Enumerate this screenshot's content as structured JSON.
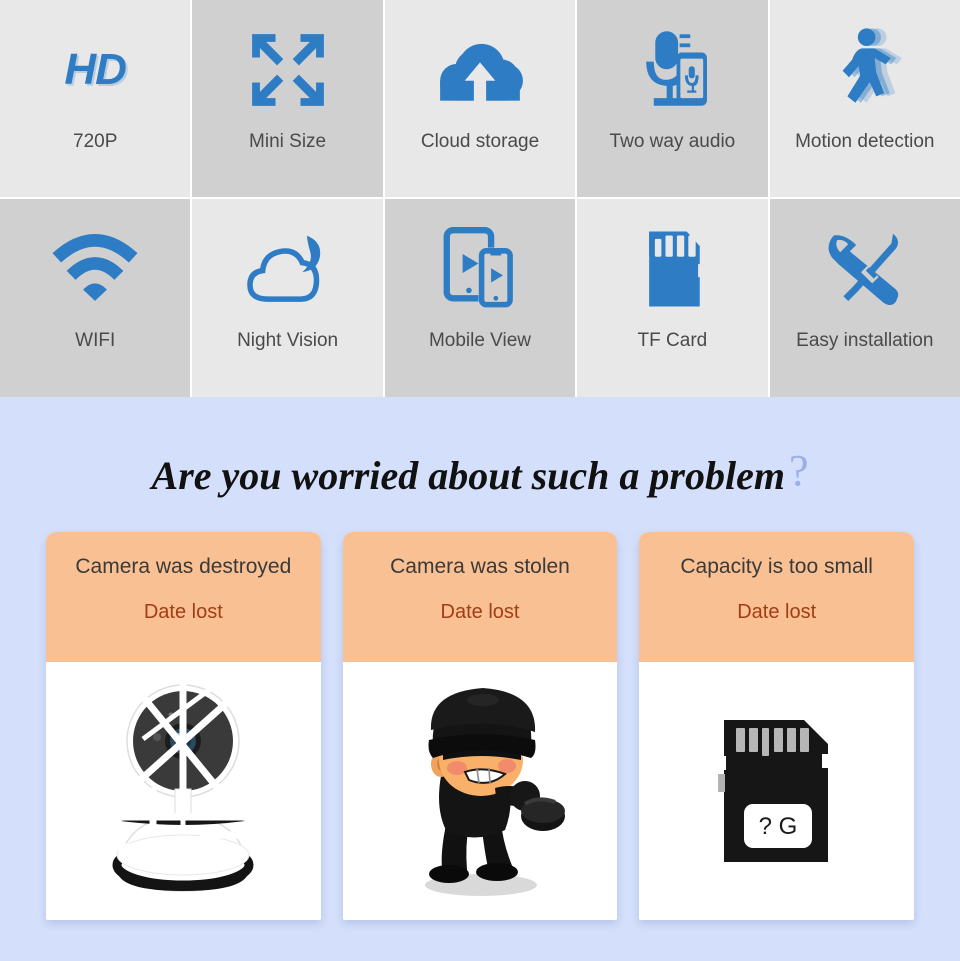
{
  "features": {
    "row1": [
      {
        "label": "720P",
        "icon": "hd-badge-icon",
        "shade": "light",
        "badge_text": "HD"
      },
      {
        "label": "Mini Size",
        "icon": "compress-arrows-icon",
        "shade": "dark"
      },
      {
        "label": "Cloud storage",
        "icon": "cloud-upload-icon",
        "shade": "light"
      },
      {
        "label": "Two way audio",
        "icon": "microphone-phone-icon",
        "shade": "dark"
      },
      {
        "label": "Motion detection",
        "icon": "walking-person-icon",
        "shade": "light"
      }
    ],
    "row2": [
      {
        "label": "WIFI",
        "icon": "wifi-icon",
        "shade": "dark"
      },
      {
        "label": "Night Vision",
        "icon": "cloud-moon-icon",
        "shade": "light"
      },
      {
        "label": "Mobile View",
        "icon": "tablet-phone-play-icon",
        "shade": "dark"
      },
      {
        "label": "TF Card",
        "icon": "sd-card-icon",
        "shade": "light"
      },
      {
        "label": "Easy installation",
        "icon": "wrench-screwdriver-icon",
        "shade": "dark"
      }
    ]
  },
  "problem_section": {
    "heading": "Are you worried about such a problem",
    "heading_question_mark": "?",
    "cards": [
      {
        "title": "Camera was destroyed",
        "subtitle": "Date lost",
        "illustration": "broken-ip-camera-illustration"
      },
      {
        "title": "Camera was stolen",
        "subtitle": "Date lost",
        "illustration": "cartoon-burglar-illustration"
      },
      {
        "title": "Capacity is too small",
        "subtitle": "Date lost",
        "illustration": "sd-card-illustration",
        "sd_label": "? G"
      }
    ]
  },
  "colors": {
    "accent_blue": "#2e7cc4",
    "section_background_blue": "#d4e0fb",
    "card_header_peach": "#f8c093",
    "card_subtitle_brown": "#a33d15",
    "cell_light": "#e8e8e8",
    "cell_dark": "#d0d0d0"
  }
}
